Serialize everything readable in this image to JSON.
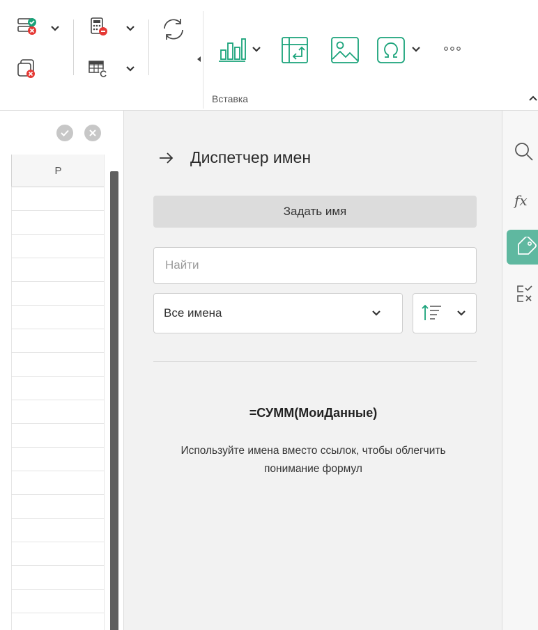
{
  "toolbar": {
    "group_label": "Вставка",
    "icons": {
      "validation": "data-validation-icon",
      "clear_validation": "clear-validation-icon",
      "calc": "calculation-options-icon",
      "recalc": "recalculate-icon",
      "refresh": "refresh-icon",
      "chart": "chart-icon",
      "pivot": "pivot-table-icon",
      "image": "image-icon",
      "symbol": "symbol-icon",
      "more": "more-icon",
      "collapse": "collapse-ribbon-icon"
    }
  },
  "sheet": {
    "column_label": "P",
    "confirm_icon": "check-icon",
    "cancel_icon": "cancel-icon"
  },
  "panel": {
    "title": "Диспетчер имен",
    "define_button": "Задать имя",
    "search_placeholder": "Найти",
    "filter_value": "Все имена",
    "formula_example": "=СУММ(МоиДанные)",
    "hint": "Используйте имена вместо ссылок, чтобы облегчить понимание формул"
  },
  "sidebar": {
    "items": [
      {
        "icon": "search-icon"
      },
      {
        "icon": "function-icon"
      },
      {
        "icon": "name-tag-icon",
        "active": true
      },
      {
        "icon": "checklist-icon"
      }
    ]
  },
  "colors": {
    "accent": "#1aa37a",
    "active_tab": "#5fb8a0",
    "error": "#e53935"
  }
}
